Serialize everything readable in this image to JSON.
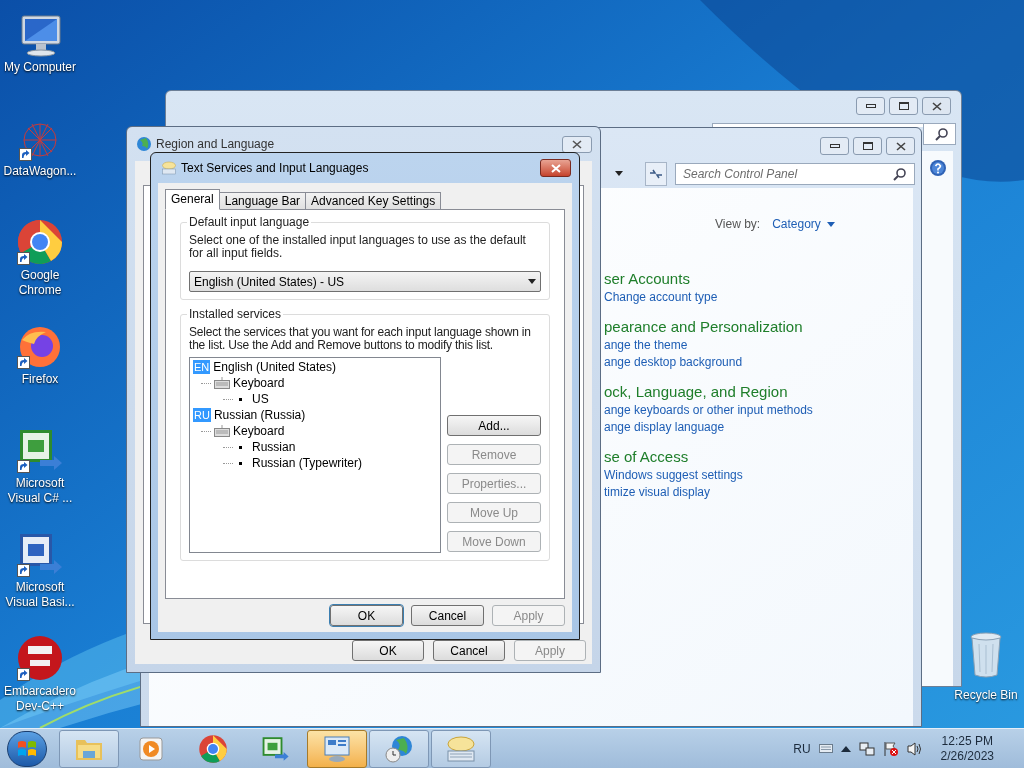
{
  "desktop_icons": [
    {
      "label": "My Computer",
      "shortcut": false
    },
    {
      "label": "DataWagon...",
      "shortcut": true
    },
    {
      "label": "Google Chrome",
      "shortcut": true
    },
    {
      "label": "Firefox",
      "shortcut": true
    },
    {
      "label": "Microsoft Visual C# ...",
      "shortcut": true
    },
    {
      "label": "Microsoft Visual Basi...",
      "shortcut": true
    },
    {
      "label": "Embarcadero Dev-C++",
      "shortcut": true
    }
  ],
  "recycle_bin": {
    "label": "Recycle Bin"
  },
  "control_panel": {
    "search": {
      "placeholder": "Search Control Panel"
    },
    "view_by": {
      "label": "View by:",
      "value": "Category"
    },
    "categories": [
      {
        "heading": "ser Accounts",
        "links": [
          "Change account type"
        ]
      },
      {
        "heading": "pearance and Personalization",
        "links": [
          "ange the theme",
          "ange desktop background"
        ]
      },
      {
        "heading": "ock, Language, and Region",
        "links": [
          "ange keyboards or other input methods",
          "ange display language"
        ]
      },
      {
        "heading": "se of Access",
        "links": [
          "Windows suggest settings",
          "timize visual display"
        ]
      }
    ]
  },
  "region_dialog": {
    "title": "Region and Language",
    "buttons": [
      {
        "label": "OK",
        "disabled": false
      },
      {
        "label": "Cancel",
        "disabled": false
      },
      {
        "label": "Apply",
        "disabled": true
      }
    ]
  },
  "text_services_dialog": {
    "title": "Text Services and Input Languages",
    "tabs": [
      {
        "label": "General",
        "selected": true
      },
      {
        "label": "Language Bar",
        "selected": false
      },
      {
        "label": "Advanced Key Settings",
        "selected": false
      }
    ],
    "default_group": {
      "title": "Default input language",
      "description": "Select one of the installed input languages to use as the default for all input fields.",
      "value": "English (United States) - US"
    },
    "services_group": {
      "title": "Installed services",
      "description": "Select the services that you want for each input language shown in the list. Use the Add and Remove buttons to modify this list.",
      "tree": [
        {
          "kind": "language",
          "badge": "EN",
          "label": "English (United States)",
          "children": [
            {
              "kind": "category",
              "label": "Keyboard",
              "children": [
                {
                  "kind": "layout",
                  "label": "US"
                }
              ]
            }
          ]
        },
        {
          "kind": "language",
          "badge": "RU",
          "label": "Russian (Russia)",
          "children": [
            {
              "kind": "category",
              "label": "Keyboard",
              "children": [
                {
                  "kind": "layout",
                  "label": "Russian"
                },
                {
                  "kind": "layout",
                  "label": "Russian (Typewriter)"
                }
              ]
            }
          ]
        }
      ],
      "side_buttons": [
        {
          "label": "Add...",
          "disabled": false
        },
        {
          "label": "Remove",
          "disabled": true
        },
        {
          "label": "Properties...",
          "disabled": true
        },
        {
          "label": "Move Up",
          "disabled": true
        },
        {
          "label": "Move Down",
          "disabled": true
        }
      ]
    },
    "buttons": [
      {
        "label": "OK",
        "disabled": false,
        "default": true
      },
      {
        "label": "Cancel",
        "disabled": false,
        "default": false
      },
      {
        "label": "Apply",
        "disabled": true,
        "default": false
      }
    ]
  },
  "taskbar": {
    "items": [
      {
        "open": true,
        "selected": false
      },
      {
        "open": false,
        "selected": false
      },
      {
        "open": false,
        "selected": false
      },
      {
        "open": false,
        "selected": false
      },
      {
        "open": true,
        "selected": true
      },
      {
        "open": true,
        "selected": false
      },
      {
        "open": true,
        "selected": false
      }
    ],
    "tray": {
      "language": "RU",
      "time": "12:25 PM",
      "date": "2/26/2023"
    }
  }
}
